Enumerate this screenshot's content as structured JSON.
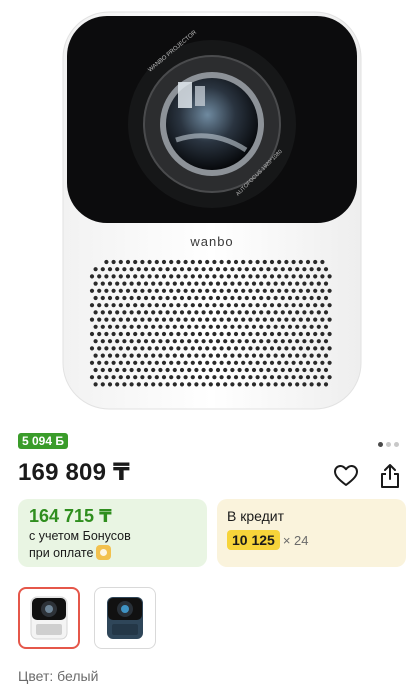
{
  "product": {
    "brand_logo": "wanbo",
    "lens_ring_top": "WANBO PROJECTOR",
    "lens_ring_bottom": "AUTOFOCUS 1920*1080",
    "gallery_dots": 3,
    "gallery_active": 1
  },
  "bonus_badge": "5 094 Б",
  "price": "169 809 ₸",
  "actions": {
    "favorite_icon": "heart-icon",
    "share_icon": "share-icon"
  },
  "bonus_card": {
    "price": "164 715 ₸",
    "line1": "с учетом Бонусов",
    "line2": "при оплате"
  },
  "credit_card": {
    "title": "В кредит",
    "amount": "10 125",
    "times": "× 24"
  },
  "variants": [
    {
      "name": "белый",
      "selected": true
    },
    {
      "name": "темно-синий",
      "selected": false
    }
  ],
  "color_label": "Цвет: белый",
  "colors": {
    "green_accent": "#3a9c2a",
    "credit_highlight": "#f7d43a",
    "selected_border": "#e5574a"
  }
}
